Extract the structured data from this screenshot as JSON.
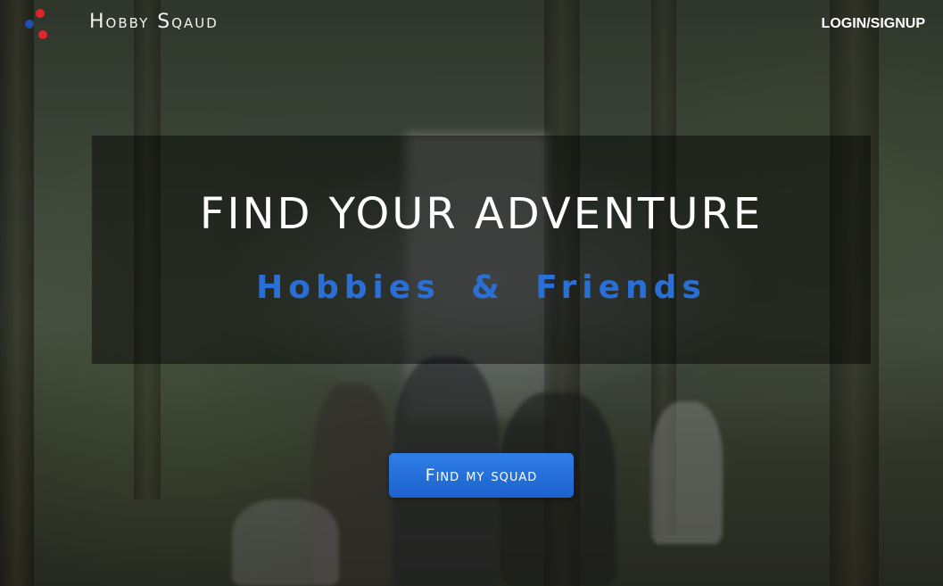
{
  "header": {
    "brand": "Hobby Sqaud",
    "login_label": "LOGIN/SIGNUP"
  },
  "hero": {
    "title": "FIND YOUR ADVENTURE",
    "subtitle": "Hobbies & Friends"
  },
  "cta": {
    "label": "Find my squad"
  },
  "colors": {
    "accent": "#2a6fd6",
    "logo_red": "#e0252f",
    "logo_blue": "#1f4fa8"
  },
  "icons": {
    "logo": "three-dot-logo-icon"
  }
}
